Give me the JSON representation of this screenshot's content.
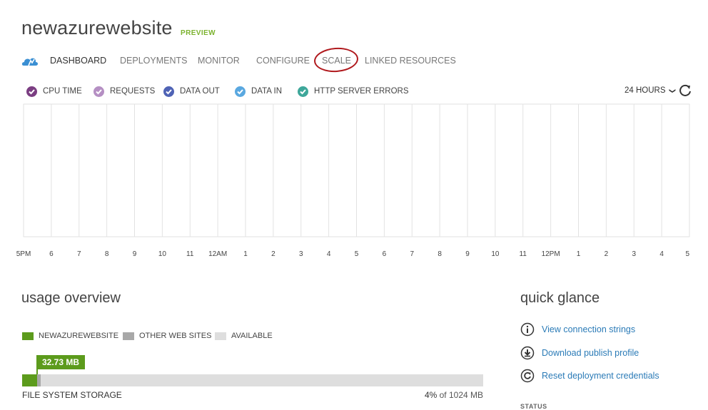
{
  "header": {
    "site_name": "newazurewebsite",
    "preview_badge": "PREVIEW"
  },
  "tabs": [
    {
      "label": "DASHBOARD",
      "active": true
    },
    {
      "label": "DEPLOYMENTS",
      "active": false
    },
    {
      "label": "MONITOR",
      "active": false
    },
    {
      "label": "CONFIGURE",
      "active": false
    },
    {
      "label": "SCALE",
      "active": false,
      "highlighted": true
    },
    {
      "label": "LINKED RESOURCES",
      "active": false
    }
  ],
  "metrics": [
    {
      "label": "CPU TIME",
      "color": "#7b3e82",
      "checked": true
    },
    {
      "label": "REQUESTS",
      "color": "#b58fc3",
      "checked": true
    },
    {
      "label": "DATA OUT",
      "color": "#4f63b5",
      "checked": true
    },
    {
      "label": "DATA IN",
      "color": "#5aa8e0",
      "checked": true
    },
    {
      "label": "HTTP SERVER ERRORS",
      "color": "#3ea79a",
      "checked": true
    }
  ],
  "time_range": {
    "selected": "24 HOURS",
    "chevron_icon": "chevron-down-icon",
    "refresh_icon": "refresh-icon"
  },
  "chart_data": {
    "type": "line",
    "x": [
      "5PM",
      "6",
      "7",
      "8",
      "9",
      "10",
      "11",
      "12AM",
      "1",
      "2",
      "3",
      "4",
      "5",
      "6",
      "7",
      "8",
      "9",
      "10",
      "11",
      "12PM",
      "1",
      "2",
      "3",
      "4",
      "5"
    ],
    "series": [],
    "grid": true
  },
  "usage_overview": {
    "title": "usage overview",
    "legend": [
      {
        "label": "NEWAZUREWEBSITE",
        "color": "#5c9b1c"
      },
      {
        "label": "OTHER WEB SITES",
        "color": "#a8a8a8"
      },
      {
        "label": "AVAILABLE",
        "color": "#dedede"
      }
    ],
    "file_system_storage": {
      "badge": "32.73 MB",
      "label": "FILE SYSTEM STORAGE",
      "percent": "4%",
      "of_total": "of 1024 MB",
      "this_site_fraction": 0.032,
      "other_sites_fraction": 0.008
    }
  },
  "quick_glance": {
    "title": "quick glance",
    "links": [
      {
        "label": "View connection strings",
        "icon": "info-icon"
      },
      {
        "label": "Download publish profile",
        "icon": "download-icon"
      },
      {
        "label": "Reset deployment credentials",
        "icon": "reset-icon"
      }
    ],
    "next_section_peek": "STATUS"
  },
  "colors": {
    "accent_green": "#7cb32f",
    "link_blue": "#2b7bb7",
    "highlight_ring": "#b0191d",
    "grid_line": "#e2e2e2"
  }
}
